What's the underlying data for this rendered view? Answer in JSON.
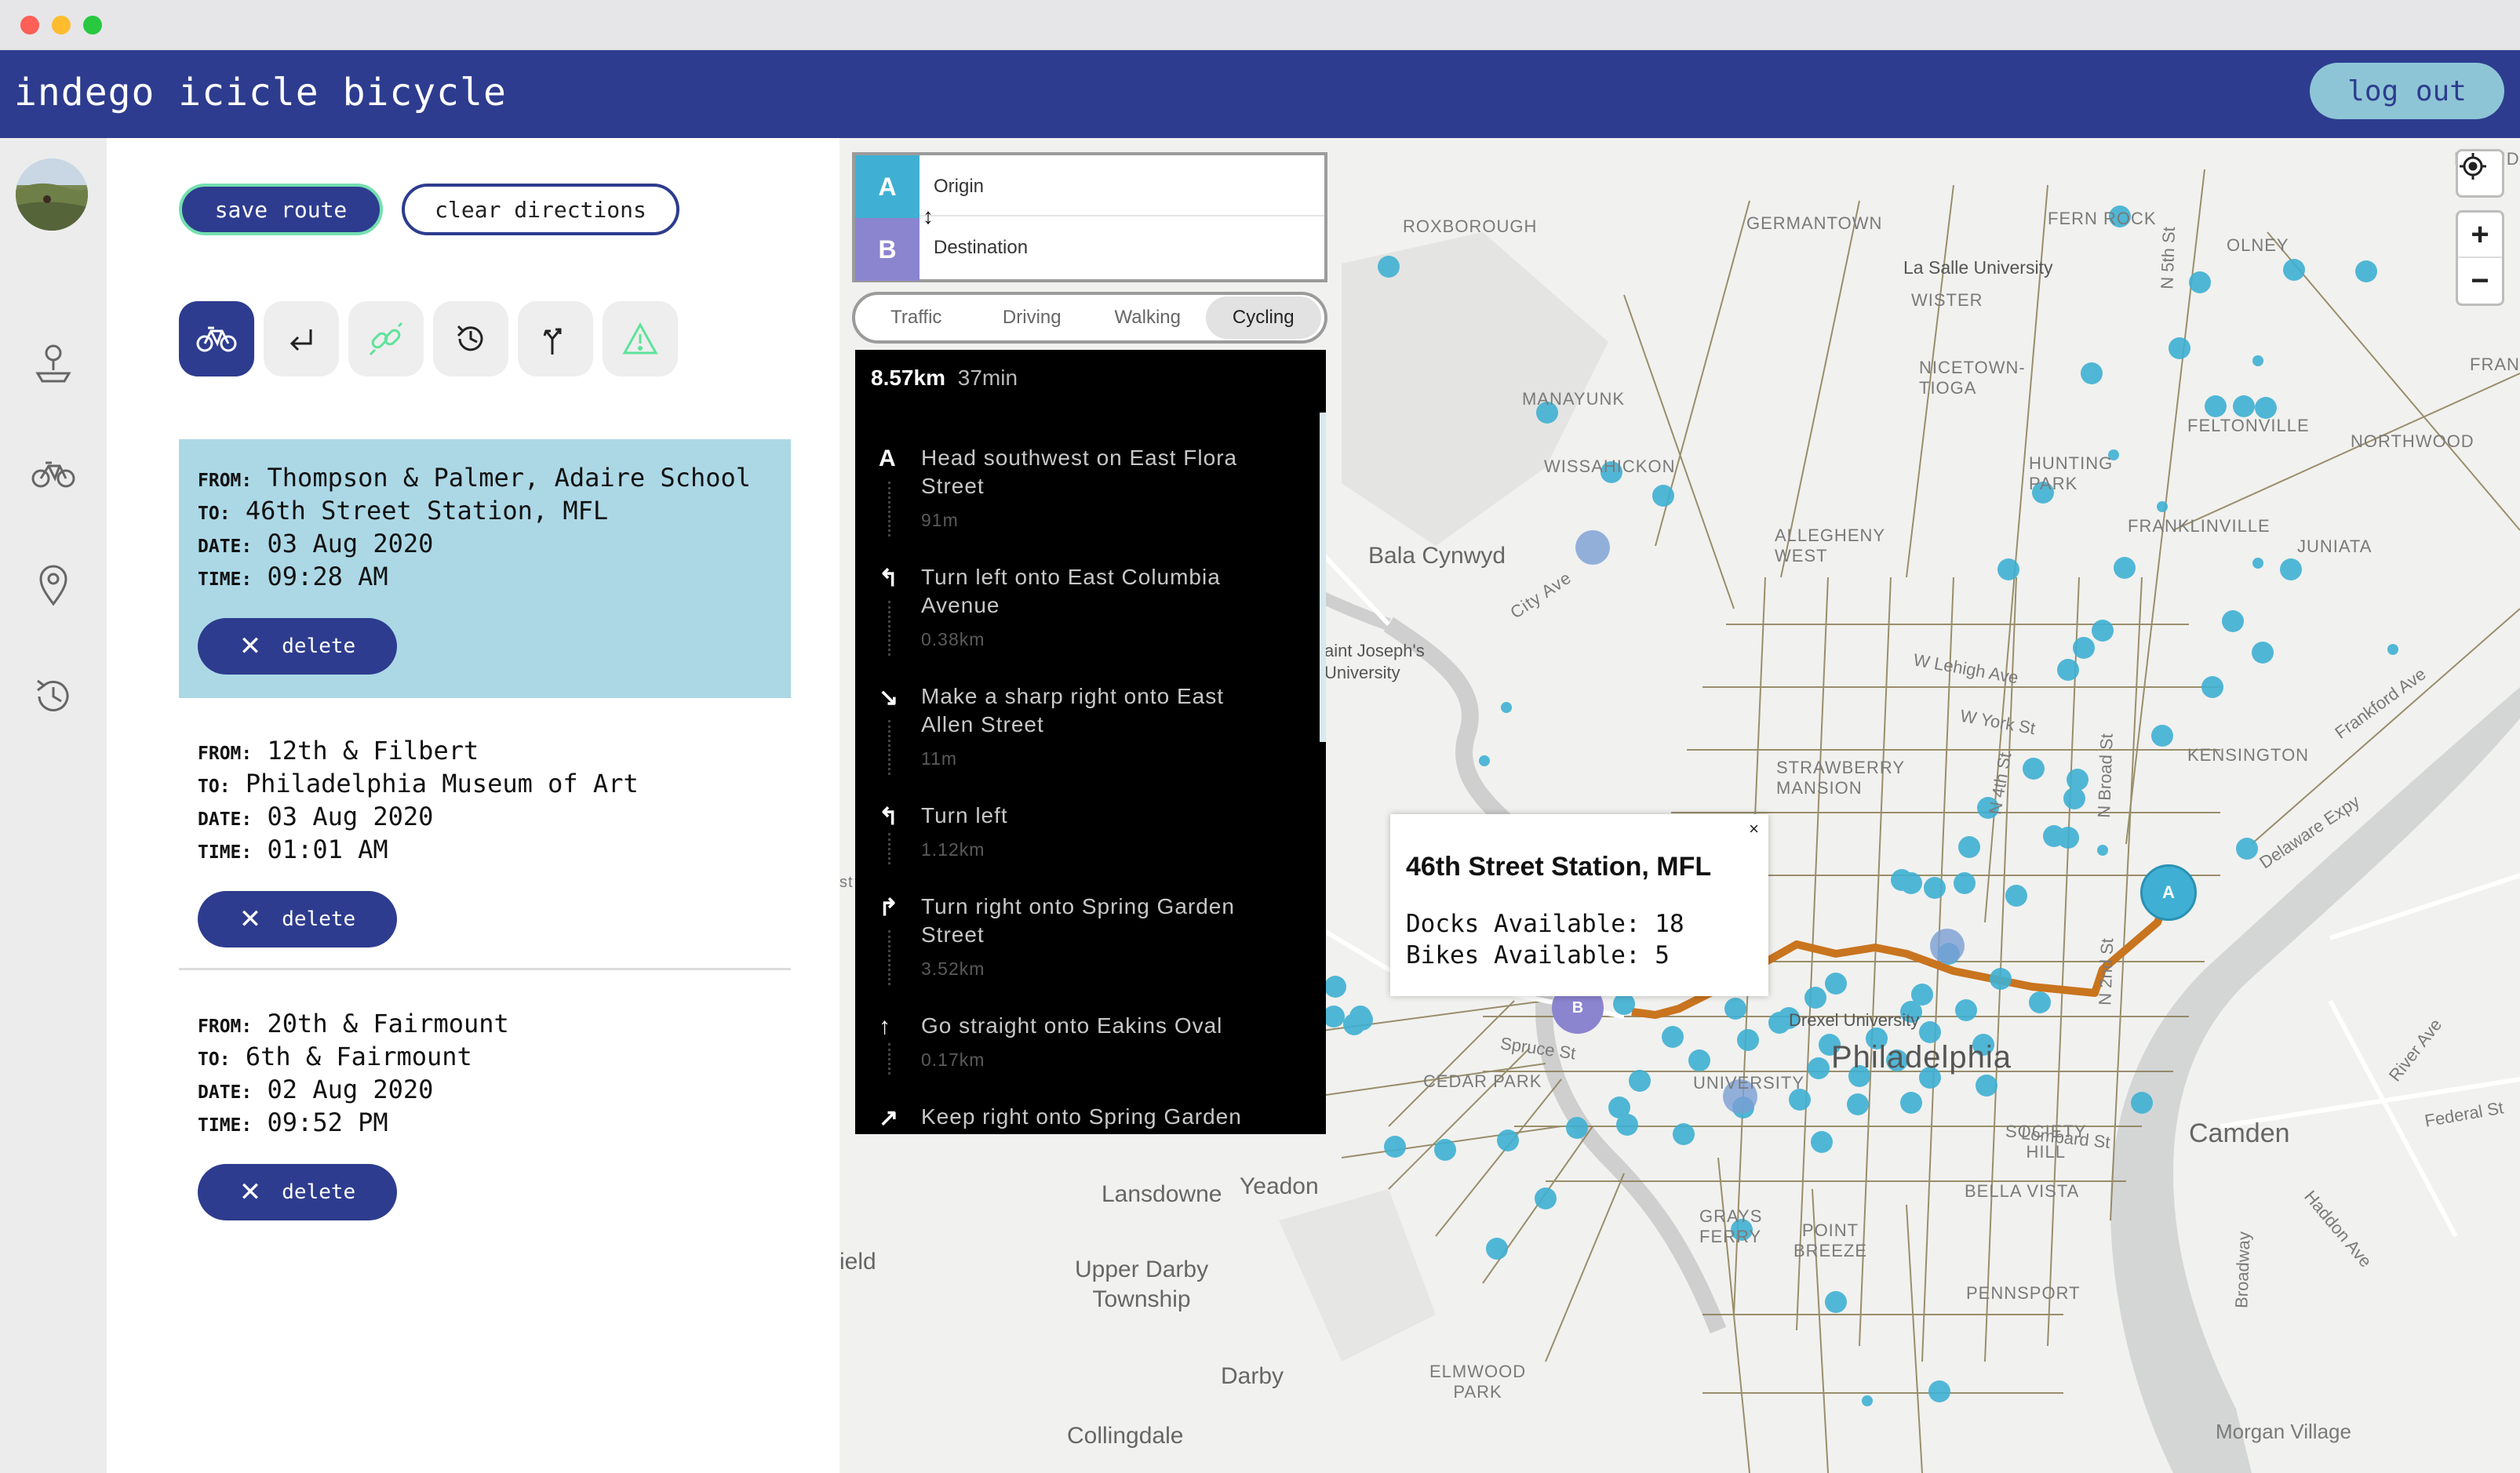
{
  "app": {
    "title": "indego icicle bicycle",
    "logout_label": "log out"
  },
  "colors": {
    "brand": "#2d3c8e",
    "accent_light": "#8ec5d6",
    "selected_card": "#acd8e6",
    "route": "#c9741e",
    "station": "#3fb0d3"
  },
  "leftnav": {
    "items": [
      "avatar",
      "map-pin-person-icon",
      "bicycle-icon",
      "location-pin-icon",
      "history-icon"
    ]
  },
  "toolbar": {
    "save_label": "save route",
    "clear_label": "clear directions",
    "tools": [
      "bicycle-icon",
      "return-arrow-icon",
      "link-icon",
      "history-icon",
      "fork-arrow-icon",
      "warning-icon"
    ]
  },
  "routes": [
    {
      "from_key": "FROM:",
      "from": "Thompson & Palmer, Adaire School",
      "to_key": "TO:",
      "to": "46th Street Station, MFL",
      "date_key": "DATE:",
      "date": "03 Aug 2020",
      "time_key": "TIME:",
      "time": "09:28 AM",
      "delete_label": "delete",
      "selected": true
    },
    {
      "from_key": "FROM:",
      "from": "12th & Filbert",
      "to_key": "TO:",
      "to": "Philadelphia Museum of Art",
      "date_key": "DATE:",
      "date": "03 Aug 2020",
      "time_key": "TIME:",
      "time": "01:01 AM",
      "delete_label": "delete",
      "selected": false
    },
    {
      "from_key": "FROM:",
      "from": "20th & Fairmount",
      "to_key": "TO:",
      "to": "6th & Fairmount",
      "date_key": "DATE:",
      "date": "02 Aug 2020",
      "time_key": "TIME:",
      "time": "09:52 PM",
      "delete_label": "delete",
      "selected": false
    }
  ],
  "directions": {
    "origin_badge": "A",
    "origin_placeholder": "Origin",
    "dest_badge": "B",
    "dest_placeholder": "Destination",
    "modes": [
      "Traffic",
      "Driving",
      "Walking",
      "Cycling"
    ],
    "active_mode": "Cycling",
    "distance": "8.57km",
    "duration": "37min",
    "steps": [
      {
        "icon": "A",
        "text": "Head southwest on East Flora Street",
        "dist": "91m"
      },
      {
        "icon": "↰",
        "text": "Turn left onto East Columbia Avenue",
        "dist": "0.38km"
      },
      {
        "icon": "↘",
        "text": "Make a sharp right onto East Allen Street",
        "dist": "11m"
      },
      {
        "icon": "↰",
        "text": "Turn left",
        "dist": "1.12km"
      },
      {
        "icon": "↱",
        "text": "Turn right onto Spring Garden Street",
        "dist": "3.52km"
      },
      {
        "icon": "↑",
        "text": "Go straight onto Eakins Oval",
        "dist": "0.17km"
      },
      {
        "icon": "↗",
        "text": "Keep right onto Spring Garden",
        "dist": ""
      }
    ]
  },
  "popup": {
    "title": "46th Street Station, MFL",
    "docks": "Docks Available: 18",
    "bikes": "Bikes Available: 5",
    "close": "×"
  },
  "map": {
    "labels": {
      "roxborough": "ROXBOROUGH",
      "germantown": "GERMANTOWN",
      "fern_rock": "FERN ROCK",
      "olney": "OLNEY",
      "lawnda": "LAWNDA",
      "la_salle": "La Salle University",
      "wister": "WISTER",
      "frankford": "FRANKFORD",
      "nicetown": "NICETOWN-\nTIOGA",
      "manayunk": "MANAYUNK",
      "feltonville": "FELTONVILLE",
      "northwood": "NORTHWOOD",
      "wissahickon": "WISSAHICKON",
      "hunting_park": "HUNTING\nPARK",
      "franklinville": "FRANKLINVILLE",
      "allegheny_west": "ALLEGHENY\nWEST",
      "juniata": "JUNIATA",
      "bala": "Bala Cynwyd",
      "city_ave": "City Ave",
      "st_josephs": "aint Joseph's\nUniversity",
      "lehigh": "W Lehigh Ave",
      "york": "W York St",
      "kensington": "KENSINGTON",
      "strawberry": "STRAWBERRY\nMANSION",
      "drexel": "Drexel University",
      "philadelphia": "Philadelphia",
      "cedar_park": "CEDAR PARK",
      "spruce": "Spruce St",
      "society_hill": "SOCIETY\nHILL",
      "camden": "Camden",
      "bella_vista": "BELLA VISTA",
      "lansdowne": "Lansdowne",
      "yeadon": "Yeadon",
      "grays_ferry": "GRAYS\nFERRY",
      "point_breeze": "POINT\nBREEZE",
      "field": "ield",
      "upper_darby": "Upper Darby\nTownship",
      "pennsport": "PENNSPORT",
      "darby": "Darby",
      "elmwood": "ELMWOOD\nPARK",
      "collingdale": "Collingdale",
      "morgan": "Morgan Village",
      "federal": "Federal St",
      "river_ave": "River Ave",
      "haddon": "Haddon Ave",
      "broadway": "Broadway",
      "delaware": "Delaware Expy",
      "frankford_ave": "Frankford Ave",
      "lombard": "Lombard St",
      "n5th": "N 5th St",
      "n4th": "N 4th St",
      "n2nd": "N 2nd St",
      "broad": "N Broad St",
      "univ": "UNIVERSITY",
      "st_left": "st"
    },
    "marker_a": "A",
    "marker_b": "B"
  }
}
